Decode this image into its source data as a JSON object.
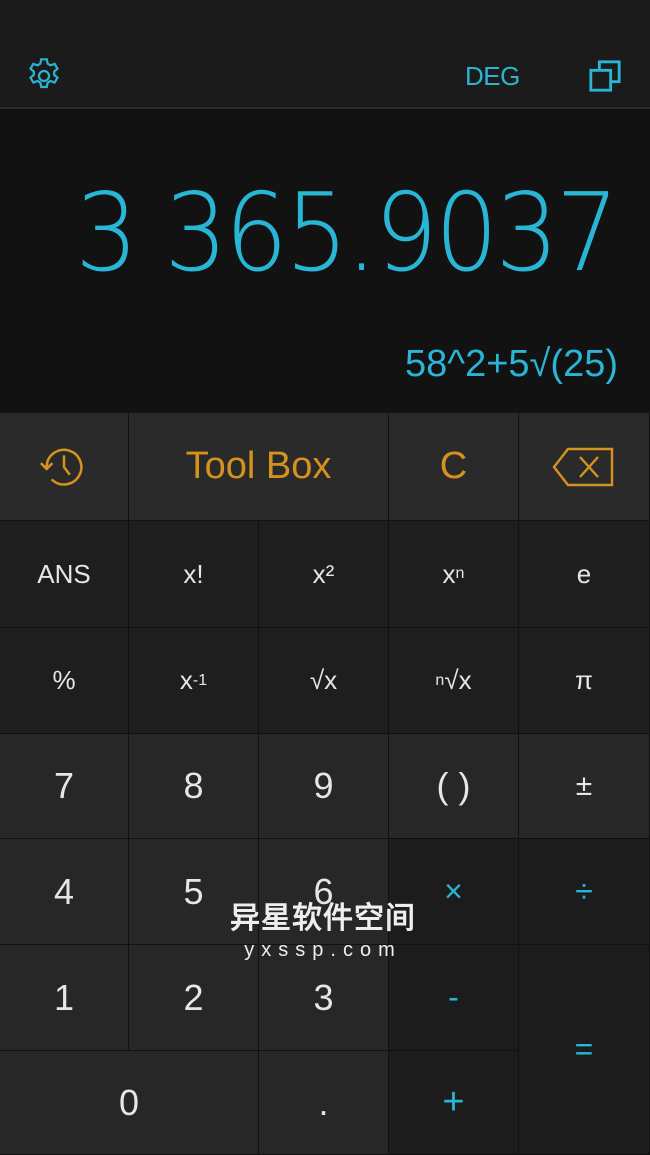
{
  "colors": {
    "accent": "#29b6d6",
    "function_accent": "#d4921e",
    "background": "#111111"
  },
  "header": {
    "settings_icon": "gear-icon",
    "angle_mode": "DEG",
    "copy_icon": "copy-icon"
  },
  "display": {
    "result": "3 365.9037",
    "expression": "58^2+5√(25)"
  },
  "top_row": {
    "history_icon": "history-icon",
    "toolbox": "Tool Box",
    "clear": "C",
    "backspace_icon": "backspace-icon"
  },
  "function_keys": [
    {
      "label": "ANS"
    },
    {
      "base": "x",
      "sup": "!"
    },
    {
      "base": "x",
      "sup": "²"
    },
    {
      "base": "x",
      "sup": "n"
    },
    {
      "label": "e"
    },
    {
      "label": "%"
    },
    {
      "base": "x",
      "sup": "-1"
    },
    {
      "label": "√x"
    },
    {
      "pre": "n",
      "base": "√x"
    },
    {
      "label": "π"
    }
  ],
  "keypad": {
    "k7": "7",
    "k8": "8",
    "k9": "9",
    "paren": "( )",
    "plusminus": "±",
    "k4": "4",
    "k5": "5",
    "k6": "6",
    "multiply": "×",
    "divide": "÷",
    "k1": "1",
    "k2": "2",
    "k3": "3",
    "minus": "-",
    "equals": "=",
    "k0": "0",
    "dot": ".",
    "plus": "+"
  },
  "watermark": {
    "line1": "异星软件空间",
    "line2": "yxssp.com"
  }
}
